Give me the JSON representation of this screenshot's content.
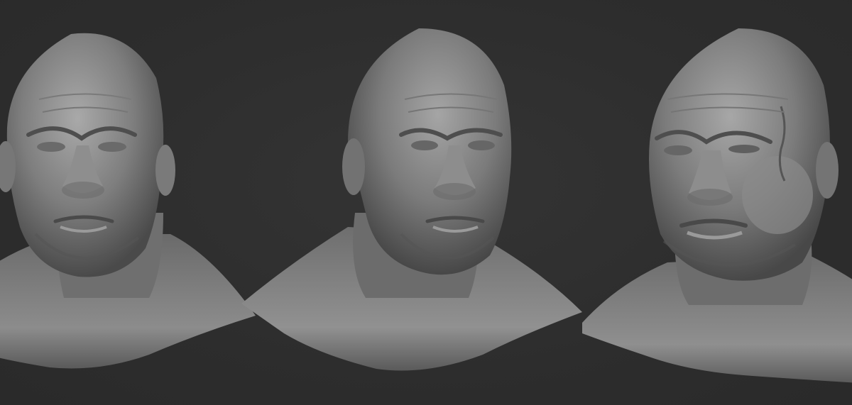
{
  "scene": {
    "background_color": "#2e2e2e",
    "material_color": "#8a8a8a",
    "views": [
      {
        "id": "front",
        "subject": "sculpted-male-head-bust"
      },
      {
        "id": "three-quarter",
        "subject": "sculpted-male-head-bust"
      },
      {
        "id": "three-quarter-swollen",
        "subject": "sculpted-male-head-bust"
      }
    ]
  }
}
